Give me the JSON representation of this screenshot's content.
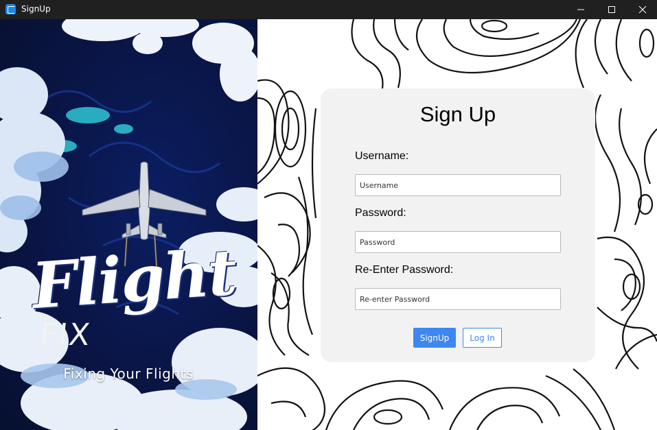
{
  "window": {
    "title": "SignUp",
    "controls": {
      "minimize": "minimize-icon",
      "maximize": "maximize-icon",
      "close": "close-icon"
    }
  },
  "branding": {
    "logo_script": "Flight",
    "logo_sub": "FIX",
    "tagline": "Fixing Your Flights"
  },
  "form": {
    "title": "Sign Up",
    "username": {
      "label": "Username:",
      "placeholder": "Username",
      "value": ""
    },
    "password": {
      "label": "Password:",
      "placeholder": "Password",
      "value": ""
    },
    "reenter": {
      "label": "Re-Enter Password:",
      "placeholder": "Re-enter Password",
      "value": ""
    },
    "signup_label": "SignUp",
    "login_label": "Log In"
  },
  "colors": {
    "titlebar": "#202020",
    "card": "#f2f2f2",
    "accent": "#3e86f0",
    "art_background": "#0a1545"
  }
}
